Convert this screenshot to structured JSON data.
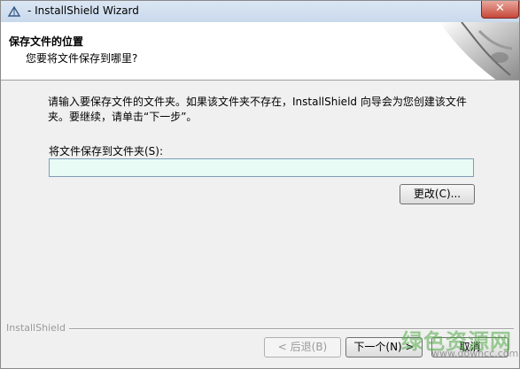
{
  "window": {
    "title": "- InstallShield Wizard",
    "close_glyph": "✕"
  },
  "header": {
    "title": "保存文件的位置",
    "subtitle": "您要将文件保存到哪里?"
  },
  "main": {
    "description": "请输入要保存文件的文件夹。如果该文件夹不存在，InstallShield 向导会为您创建该文件夹。要继续，请单击“下一步”。",
    "folder_label": "将文件保存到文件夹(S):",
    "folder_value": "",
    "change_button": "更改(C)..."
  },
  "footer": {
    "brand": "InstallShield",
    "back_button": "< 后退(B)",
    "next_button": "下一个(N) >",
    "cancel_button": "取消",
    "back_enabled": false
  },
  "watermark": {
    "text": "绿色资源网",
    "url": "www.downcc.com"
  },
  "icons": {
    "app": "installshield-icon",
    "header_art": "installshield-face-art"
  }
}
